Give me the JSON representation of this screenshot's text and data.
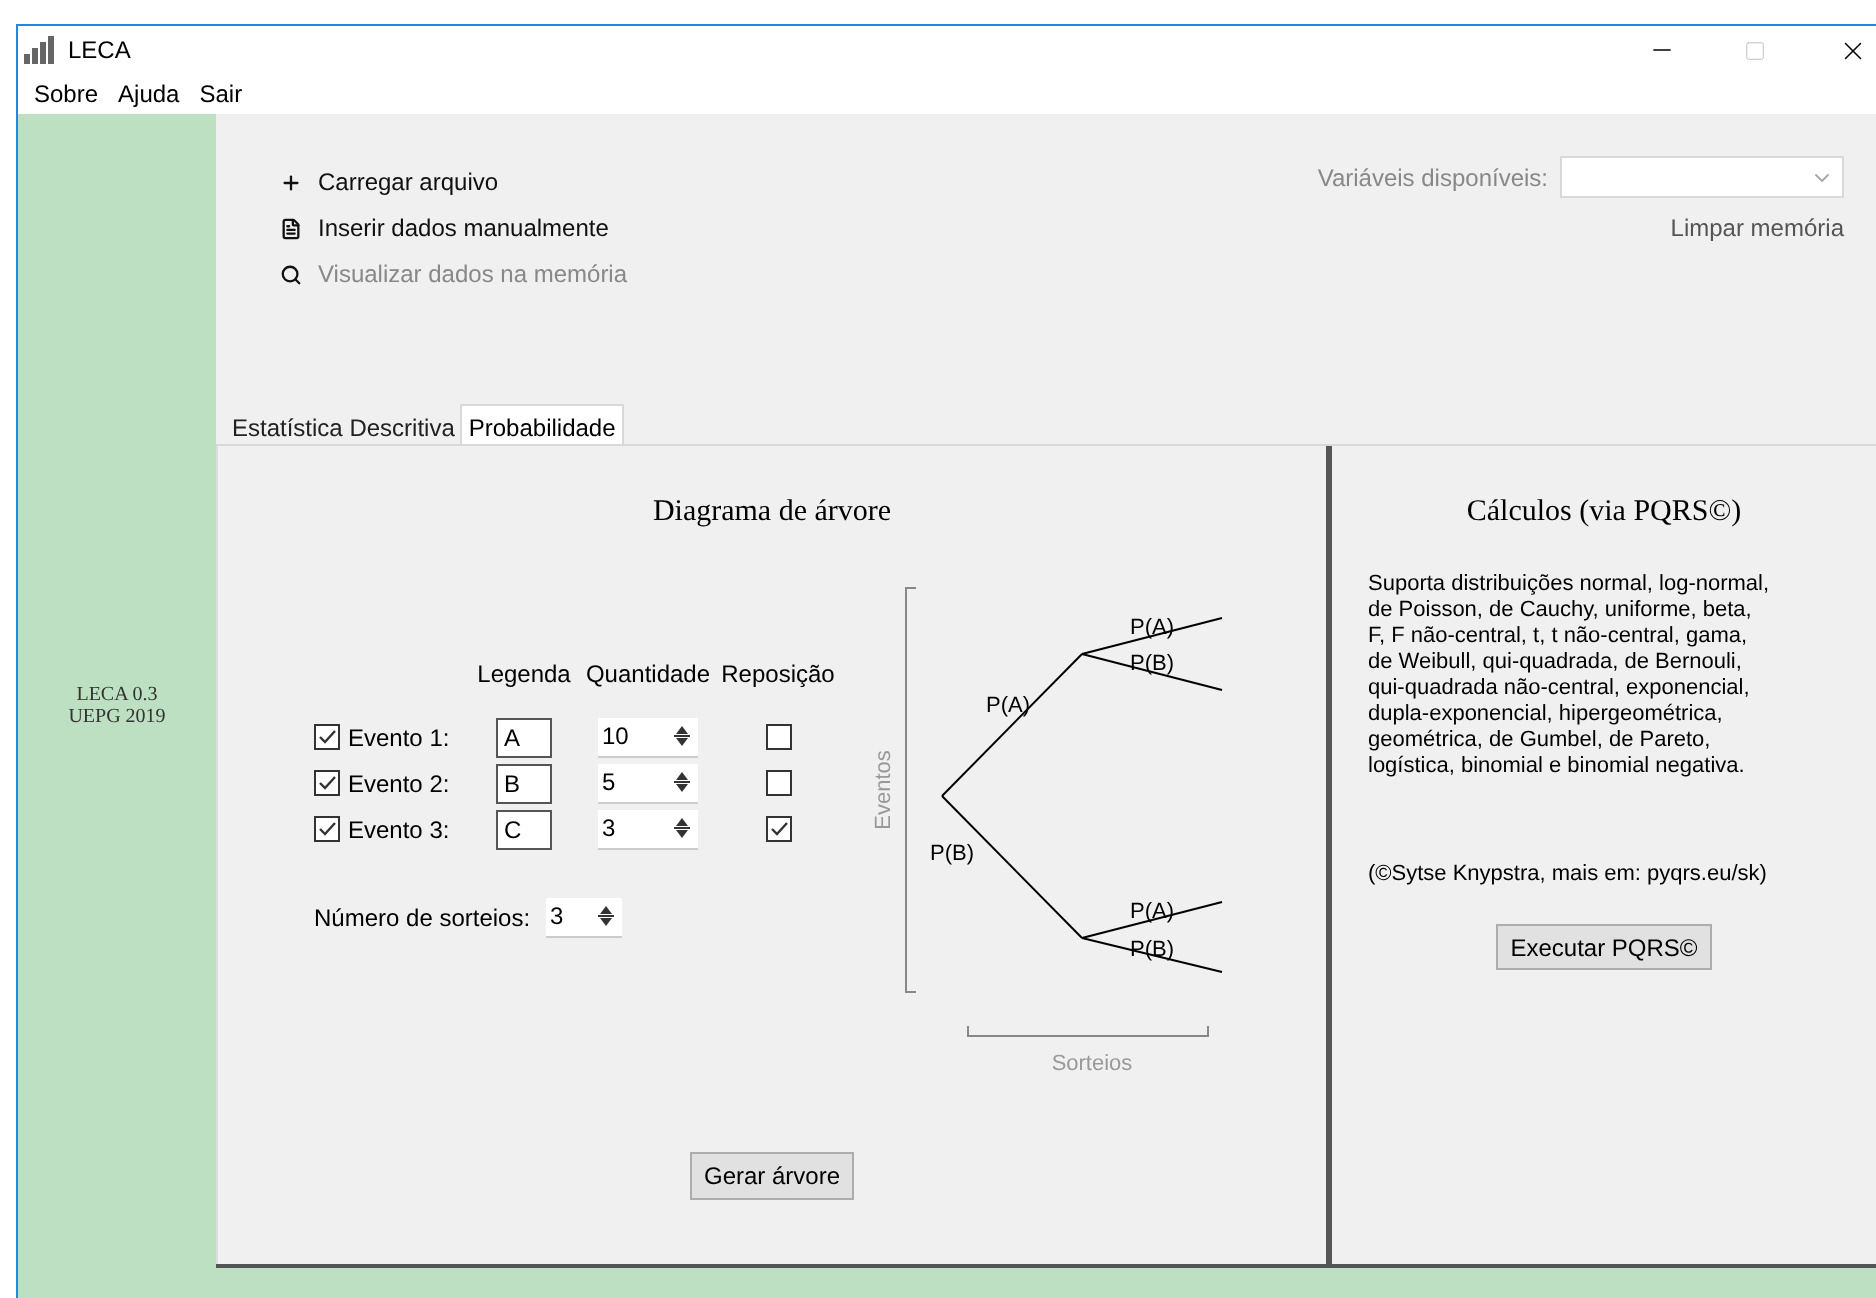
{
  "window": {
    "title": "LECA"
  },
  "menu": [
    "Sobre",
    "Ajuda",
    "Sair"
  ],
  "sidebar": {
    "lines": [
      "LECA 0.3",
      "UEPG 2019"
    ]
  },
  "actions": [
    {
      "kind": "load",
      "label": "Carregar arquivo",
      "disabled": false
    },
    {
      "kind": "manual",
      "label": "Inserir dados manualmente",
      "disabled": false
    },
    {
      "kind": "view",
      "label": "Visualizar dados na memória",
      "disabled": true
    }
  ],
  "variables": {
    "label": "Variáveis disponíveis:",
    "disabled": true
  },
  "clear_memory": "Limpar memória",
  "tabs": [
    {
      "label": "Estatística Descritiva",
      "selected": false
    },
    {
      "label": "Probabilidade",
      "selected": true
    }
  ],
  "tree_panel": {
    "title": "Diagrama de árvore",
    "columns": [
      "Legenda",
      "Quantidade",
      "Reposição"
    ],
    "events": [
      {
        "label": "Evento 1:",
        "checked": true,
        "legend": "A",
        "quantity": "10",
        "replacement": false
      },
      {
        "label": "Evento 2:",
        "checked": true,
        "legend": "B",
        "quantity": "5",
        "replacement": false
      },
      {
        "label": "Evento 3:",
        "checked": true,
        "legend": "C",
        "quantity": "3",
        "replacement": true
      }
    ],
    "draws": {
      "label": "Número de sorteios:",
      "value": "3"
    },
    "diagram": {
      "y_label": "Eventos",
      "x_label": "Sorteios",
      "branches": [
        {
          "label": "P(A)",
          "children": [
            {
              "label": "P(A)"
            },
            {
              "label": "P(B)"
            }
          ]
        },
        {
          "label": "P(B)",
          "children": [
            {
              "label": "P(A)"
            },
            {
              "label": "P(B)"
            }
          ]
        }
      ]
    },
    "button": "Gerar árvore"
  },
  "calc_panel": {
    "title": "Cálculos (via PQRS©)",
    "description": "Suporta distribuições normal, log-normal,\nde Poisson,  de Cauchy,  uniforme,  beta,\nF,  F não-central,  t,  t não-central,  gama,\nde Weibull,  qui-quadrada,  de Bernouli,\nqui-quadrada não-central,  exponencial,\ndupla-exponencial,   hipergeométrica,\ngeométrica,   de  Gumbel,   de  Pareto,\nlogística,  binomial e binomial negativa.",
    "credit": "(©Sytse Knypstra, mais em: pyqrs.eu/sk)",
    "button": "Executar PQRS©"
  }
}
